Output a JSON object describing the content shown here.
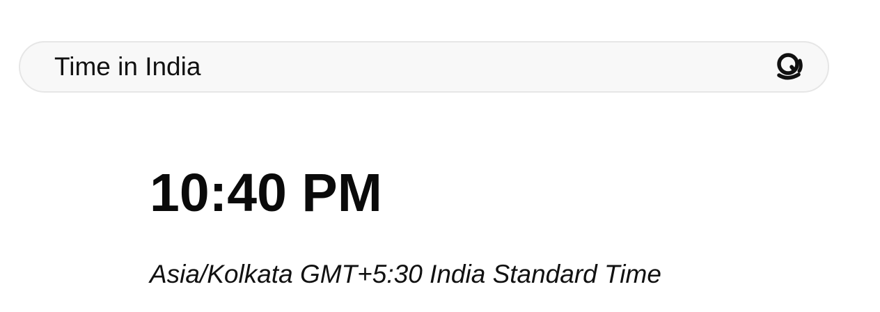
{
  "search": {
    "value": "Time in India",
    "icon": "search-icon"
  },
  "result": {
    "time": "10:40 PM",
    "timezone": "Asia/Kolkata GMT+5:30 India Standard Time"
  }
}
